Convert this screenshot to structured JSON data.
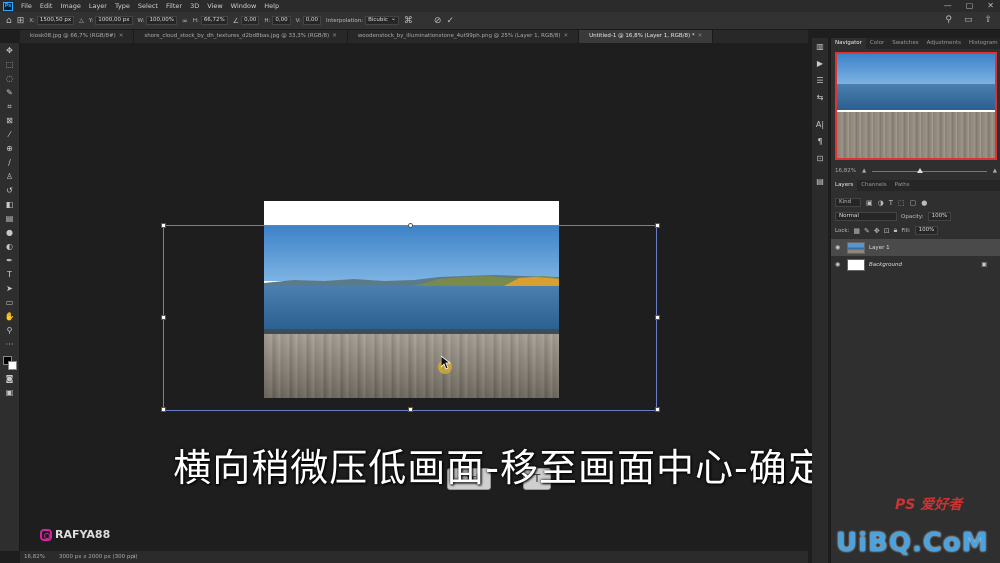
{
  "menubar": {
    "logo": "Ps",
    "items": [
      "File",
      "Edit",
      "Image",
      "Layer",
      "Type",
      "Select",
      "Filter",
      "3D",
      "View",
      "Window",
      "Help"
    ],
    "controls": [
      "—",
      "▢",
      "✕"
    ]
  },
  "options": {
    "x_label": "X:",
    "x_value": "1500,50 px",
    "y_label": "Y:",
    "y_value": "1000,00 px",
    "w_label": "W:",
    "w_value": "100,00%",
    "h_label": "H:",
    "h_value": "66,72%",
    "angle_value": "0,00",
    "hskew_label": "H:",
    "hskew_value": "0,00",
    "vskew_label": "V:",
    "vskew_value": "0,00",
    "interp_label": "Interpolation:",
    "interp_value": "Bicubic"
  },
  "tabs": [
    {
      "label": "kiosk08.jpg @ 66,7% (RGB/8#)",
      "active": false
    },
    {
      "label": "shore_cloud_stock_by_dh_textures_d2bd8bas.jpg @ 33,3% (RGB/8)",
      "active": false
    },
    {
      "label": "woodenstock_by_illuminationstone_4ut99ph.png @ 25% (Layer 1, RGB/8)",
      "active": false
    },
    {
      "label": "Untitled-1 @ 16,8% (Layer 1, RGB/8) *",
      "active": true
    }
  ],
  "status": {
    "zoom": "16,82%",
    "doc_info": "3000 px x 2000 px (300 ppi)"
  },
  "subtitle": "横向稍微压低画面-移至画面中心-确定",
  "key_hints": [
    "Ctrl",
    "T"
  ],
  "watermark_ig": "RAFYA88",
  "watermark_site": "UiBQ.CoM",
  "watermark_ps": "PS 爱好者",
  "navigator": {
    "tabs": [
      "Navigator",
      "Color",
      "Swatches",
      "Adjustments",
      "Histogram"
    ],
    "zoom": "16,82%"
  },
  "layers": {
    "tabs": [
      "Layers",
      "Channels",
      "Paths"
    ],
    "kind": "Kind",
    "blend_mode": "Normal",
    "opacity_label": "Opacity:",
    "opacity_value": "100%",
    "lock_label": "Lock:",
    "fill_label": "Fill:",
    "fill_value": "100%",
    "items": [
      {
        "name": "Layer 1",
        "selected": true
      },
      {
        "name": "Background",
        "selected": false
      }
    ]
  }
}
